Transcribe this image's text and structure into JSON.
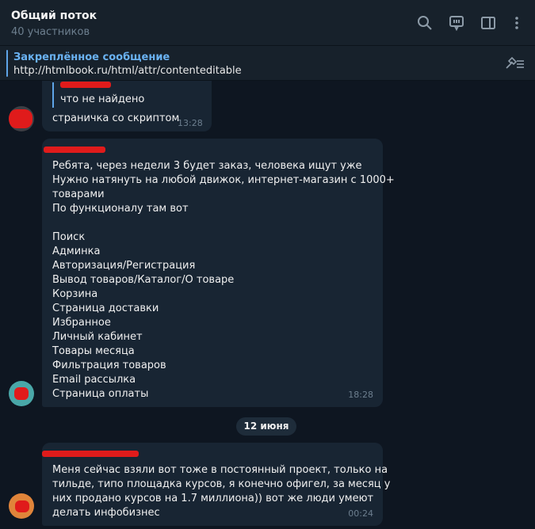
{
  "header": {
    "title": "Общий поток",
    "subtitle": "40 участников"
  },
  "pinned": {
    "label": "Закреплённое сообщение",
    "text": "http://htmlbook.ru/html/attr/contenteditable"
  },
  "messages": [
    {
      "reply_text": "что не найдено",
      "text": "страничка со скриптом",
      "time": "13:28"
    },
    {
      "lines": [
        "Ребята, через недели 3 будет заказ, человека ищут уже",
        "Нужно натянуть на любой движок, интернет-магазин с 1000+",
        "товарами",
        "По функционалу там вот",
        "",
        "Поиск",
        "Админка",
        "Авторизация/Регистрация",
        "Вывод товаров/Каталог/О товаре",
        "Корзина",
        "Страница доставки",
        "Избранное",
        "Личный кабинет",
        "Товары месяца",
        "Фильтрация товаров",
        "Email рассылка",
        "Страница оплаты"
      ],
      "time": "18:28"
    },
    {
      "lines": [
        "Меня сейчас взяли вот тоже в постоянный проект, только на",
        "тильде, типо площадка курсов, я конечно офигел, за месяц у",
        "них продано курсов на 1.7 миллиона)) вот же люди умеют",
        "делать инфобизнес"
      ],
      "time": "00:24"
    }
  ],
  "date_separator": "12 июня",
  "icons": [
    "search-icon",
    "chat-icon",
    "sidebar-icon",
    "more-icon",
    "pin-list-icon"
  ],
  "colors": {
    "background": "#0e1621",
    "header": "#17212b",
    "bubble": "#182533",
    "accent": "#6ab2f2",
    "redaction": "#e01b1b"
  }
}
